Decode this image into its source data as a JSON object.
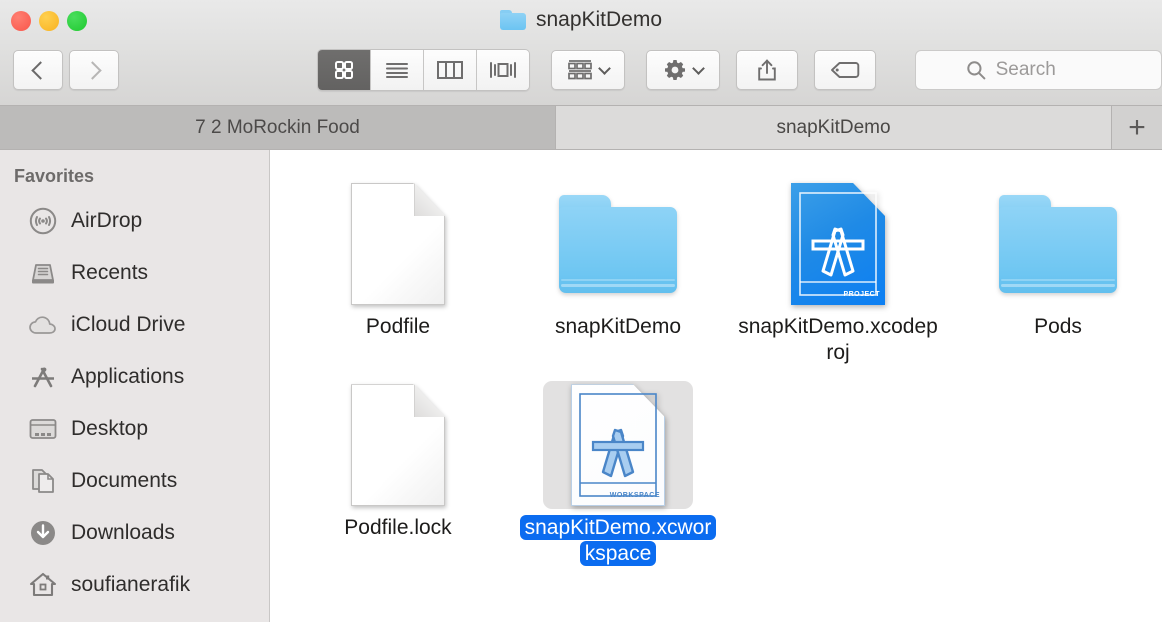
{
  "window": {
    "title": "snapKitDemo",
    "traffic_lights": [
      "close",
      "minimize",
      "maximize"
    ]
  },
  "toolbar": {
    "back_icon": "chevron-left-icon",
    "forward_icon": "chevron-right-icon",
    "view_modes": [
      {
        "name": "icon-view",
        "icon": "grid-icon",
        "active": true
      },
      {
        "name": "list-view",
        "icon": "list-icon",
        "active": false
      },
      {
        "name": "column-view",
        "icon": "columns-icon",
        "active": false
      },
      {
        "name": "gallery-view",
        "icon": "gallery-icon",
        "active": false
      }
    ],
    "arrange_button": {
      "name": "arrange-by-button",
      "icon": "group-icon"
    },
    "action_button": {
      "name": "action-menu-button",
      "icon": "gear-icon"
    },
    "share_button": {
      "name": "share-button",
      "icon": "share-icon"
    },
    "tags_button": {
      "name": "tags-button",
      "icon": "tag-icon"
    }
  },
  "search": {
    "placeholder": "Search",
    "value": "",
    "icon": "search-icon"
  },
  "tabs": {
    "items": [
      {
        "label": "7 2 MoRockin Food",
        "active": false
      },
      {
        "label": "snapKitDemo",
        "active": true
      }
    ],
    "add_label": "+"
  },
  "sidebar": {
    "section_title": "Favorites",
    "items": [
      {
        "label": "AirDrop",
        "icon": "airdrop-icon"
      },
      {
        "label": "Recents",
        "icon": "recents-icon"
      },
      {
        "label": "iCloud Drive",
        "icon": "icloud-icon"
      },
      {
        "label": "Applications",
        "icon": "applications-icon"
      },
      {
        "label": "Desktop",
        "icon": "desktop-icon"
      },
      {
        "label": "Documents",
        "icon": "documents-icon"
      },
      {
        "label": "Downloads",
        "icon": "downloads-icon"
      },
      {
        "label": "soufianerafik",
        "icon": "home-icon"
      }
    ]
  },
  "files": [
    {
      "label": "Podfile",
      "kind": "document",
      "selected": false
    },
    {
      "label": "snapKitDemo",
      "kind": "folder",
      "selected": false
    },
    {
      "label": "snapKitDemo.xcodeproj",
      "kind": "xcodeproj",
      "selected": false,
      "badge": "PROJECT"
    },
    {
      "label": "Pods",
      "kind": "folder",
      "selected": false
    },
    {
      "label": "Podfile.lock",
      "kind": "document",
      "selected": false
    },
    {
      "label": "snapKitDemo.xcworkspace",
      "kind": "xcworkspace",
      "selected": true,
      "badge": "WORKSPACE"
    }
  ],
  "colors": {
    "selection_blue": "#0b6cf0",
    "folder_blue": "#6ec6f2",
    "xcode_project_blue": "#1f8ae6",
    "sidebar_bg": "#e9e6e6",
    "active_tab_bg": "#dcdbda",
    "inactive_tab_bg": "#bcbbba"
  }
}
